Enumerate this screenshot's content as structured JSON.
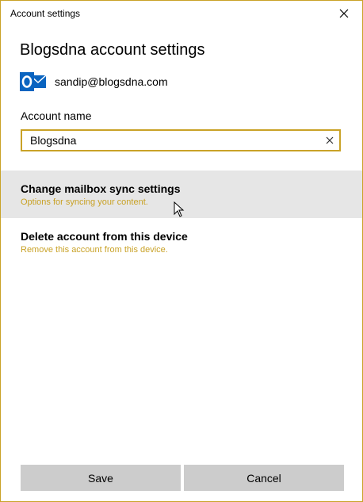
{
  "window": {
    "title": "Account settings",
    "close_icon": "close-icon"
  },
  "main": {
    "heading": "Blogsdna account settings",
    "account_email": "sandip@blogsdna.com",
    "account_icon": "outlook-icon",
    "account_name_label": "Account name",
    "account_name_value": "Blogsdna",
    "clear_icon": "clear-icon"
  },
  "options": [
    {
      "title": "Change mailbox sync settings",
      "subtitle": "Options for syncing your content."
    },
    {
      "title": "Delete account from this device",
      "subtitle": "Remove this account from this device."
    }
  ],
  "footer": {
    "save_label": "Save",
    "cancel_label": "Cancel"
  },
  "colors": {
    "accent": "#c9a227",
    "hover": "#e6e6e6",
    "button": "#cccccc",
    "outlook_blue": "#0a64c0"
  }
}
